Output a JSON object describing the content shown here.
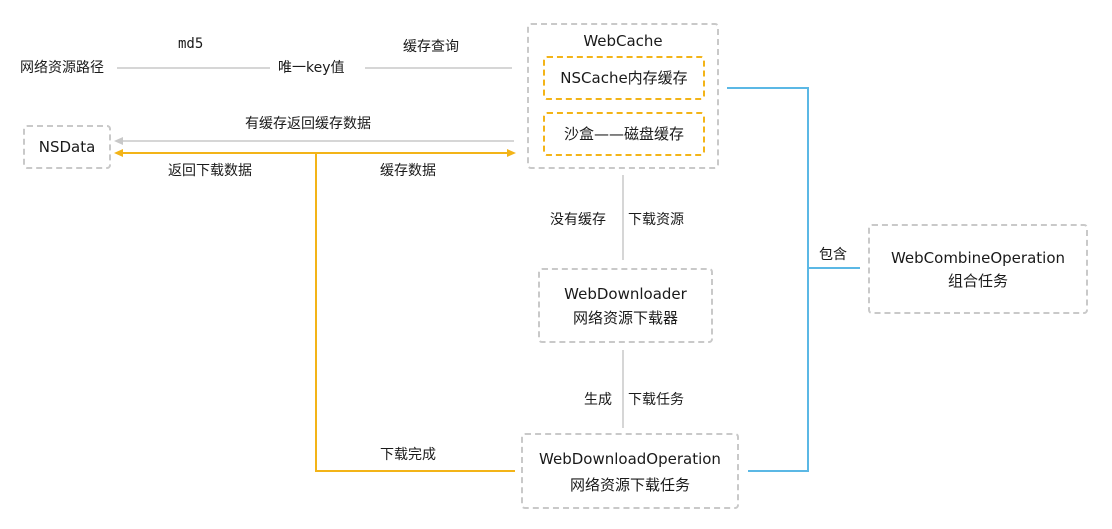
{
  "diagram": {
    "colors": {
      "gray_line": "#c8c8c8",
      "orange_line": "#f3b418",
      "blue_line": "#5bb8e5",
      "box_border": "#c9c9c9",
      "orange_box": "#f3b418"
    },
    "labels": {
      "resource_path": "网络资源路径",
      "md5": "md5",
      "unique_key": "唯一key值",
      "cache_query": "缓存查询",
      "has_cache_return": "有缓存返回缓存数据",
      "return_download_data": "返回下载数据",
      "cache_data": "缓存数据",
      "no_cache": "没有缓存",
      "download_resource": "下载资源",
      "contains": "包含",
      "generate": "生成",
      "download_task": "下载任务",
      "download_complete": "下载完成"
    },
    "nodes": {
      "nsdata": "NSData",
      "webcache": "WebCache",
      "nscache": "NSCache内存缓存",
      "sandbox": "沙盒——磁盘缓存",
      "downloader_title": "WebDownloader",
      "downloader_sub": "网络资源下载器",
      "operation_title": "WebDownloadOperation",
      "operation_sub": "网络资源下载任务",
      "combine_title": "WebCombineOperation",
      "combine_sub": "组合任务"
    }
  }
}
